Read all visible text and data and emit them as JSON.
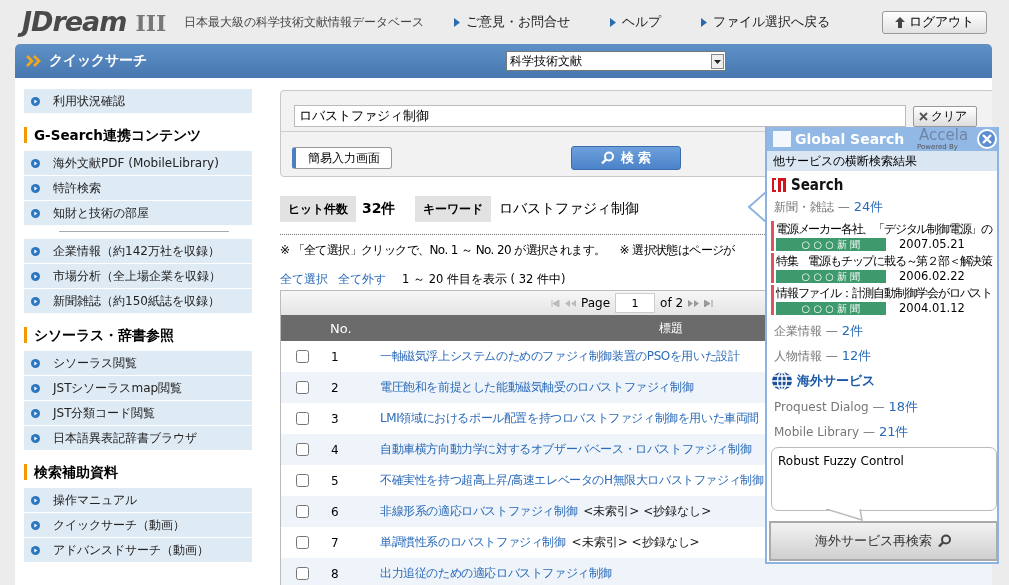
{
  "header": {
    "logo": "JDream",
    "logo_suffix": "III",
    "tagline": "日本最大級の科学技術文献情報データベース",
    "links": [
      "ご意見・お問合せ",
      "ヘルプ",
      "ファイル選択へ戻る"
    ],
    "logout": "ログアウト"
  },
  "title_bar": {
    "title": "クイックサーチ",
    "database": "科学技術文献"
  },
  "sidebar": {
    "sections": [
      {
        "items": [
          "利用状況確認"
        ]
      },
      {
        "heading": "G-Search連携コンテンツ",
        "items": [
          "海外文献PDF (MobileLibrary)",
          "特許検索",
          "知財と技術の部屋"
        ]
      },
      {
        "items": [
          "企業情報（約142万社を収録）",
          "市場分析（全上場企業を収録）",
          "新聞雑誌（約150紙誌を収録）"
        ]
      },
      {
        "heading": "シソーラス・辞書参照",
        "items": [
          "シソーラス閲覧",
          "JSTシソーラスmap閲覧",
          "JST分類コード閲覧",
          "日本語異表記辞書ブラウザ"
        ]
      },
      {
        "heading": "検索補助資料",
        "items": [
          "操作マニュアル",
          "クイックサーチ（動画）",
          "アドバンスドサーチ（動画）"
        ]
      }
    ]
  },
  "search": {
    "query": "ロバストファジィ制御",
    "clear": "クリア",
    "simple_input": "簡易入力画面",
    "search_button": "検 索"
  },
  "summary": {
    "hits_label": "ヒット件数",
    "hits": "32件",
    "keyword_label": "キーワード",
    "keyword": "ロバストファジィ制御"
  },
  "notes": [
    "※ 「全て選択」クリックで、No. 1 ～ No. 20 が選択されます。",
    "※ 選択状態はページが"
  ],
  "select_all": "全て選択",
  "deselect_all": "全て外す",
  "range": "1 ～ 20 件目を表示 ( 32 件中)",
  "pager": {
    "page_label": "Page",
    "page": "1",
    "of": "of 2"
  },
  "table": {
    "columns": [
      "No.",
      "標題"
    ],
    "rows": [
      {
        "checked": false,
        "no": "1",
        "title": "一軸磁気浮上システムのためのファジィ制御装置のPSOを用いた設計"
      },
      {
        "checked": false,
        "no": "2",
        "title": "電圧飽和を前提とした能動磁気軸受のロバストファジィ制御"
      },
      {
        "checked": false,
        "no": "3",
        "title": "LMI領域におけるポール配置を持つロバストファジィ制御を用いた車両間"
      },
      {
        "checked": false,
        "no": "4",
        "title": "自動車横方向動力学に対するオブザーバベース・ロバストファジィ制御"
      },
      {
        "checked": false,
        "no": "5",
        "title": "不確実性を持つ超高上昇/高速エレベータのH無限大ロバストファジィ制御"
      },
      {
        "checked": false,
        "no": "6",
        "title": "非線形系の適応ロバストファジィ制御",
        "note": "<未索引> <抄録なし>"
      },
      {
        "checked": false,
        "no": "7",
        "title": "単調慣性系のロバストファジィ制御",
        "note": "<未索引> <抄録なし>"
      },
      {
        "checked": false,
        "no": "8",
        "title": "出力追従のための適応ロバストファジィ制御"
      }
    ]
  },
  "global_search": {
    "title": "Global Search",
    "powered_by": "Powered By",
    "brand": "Accela",
    "subtitle": "他サービスの横断検索結果",
    "gsearch_logo": "Search",
    "news": {
      "label": "新聞・雑誌 —",
      "count": "24件"
    },
    "articles": [
      {
        "title": "電源メーカー各社、「デジタル制御電源」の",
        "source": "○ ○ ○ 新 聞",
        "date": "2007.05.21"
      },
      {
        "title": "特集　電源もチップに載る～第２部＜解決策",
        "source": "○ ○ ○ 新 聞",
        "date": "2006.02.22"
      },
      {
        "title": "情報ファイル：計測自動制御学会がロバスト",
        "source": "○ ○ ○ 新 聞",
        "date": "2004.01.12"
      }
    ],
    "counts": [
      {
        "label": "企業情報 —",
        "count": "2件"
      },
      {
        "label": "人物情報 —",
        "count": "12件"
      }
    ],
    "overseas_heading": "海外サービス",
    "overseas": [
      {
        "label": "Proquest Dialog —",
        "count": "18件"
      },
      {
        "label": "Mobile Library —",
        "count": "21件"
      }
    ],
    "query": "Robust Fuzzy Control",
    "research_button": "海外サービス再検索"
  }
}
